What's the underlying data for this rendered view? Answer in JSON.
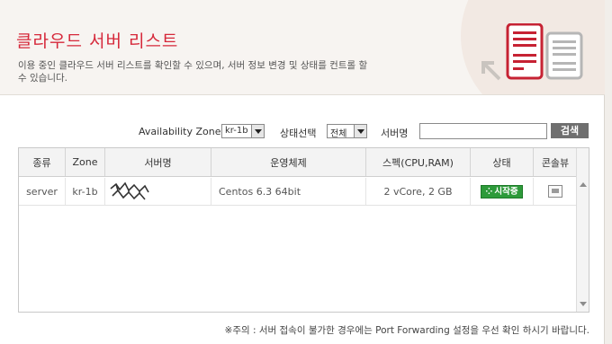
{
  "header": {
    "title": "클라우드 서버 리스트",
    "description": "이용 중인 클라우드 서버 리스트를 확인할 수 있으며, 서버 정보 변경 및 상태를 컨트롤 할 수 있습니다."
  },
  "filters": {
    "zone_label": "Availability Zone",
    "zone_value": "kr-1b",
    "status_label": "상태선택",
    "status_value": "전체",
    "name_label": "서버명",
    "name_value": "",
    "search_button": "검색"
  },
  "table": {
    "columns": [
      "종류",
      "Zone",
      "서버명",
      "운영체제",
      "스펙(CPU,RAM)",
      "상태",
      "콘솔뷰"
    ],
    "rows": [
      {
        "type": "server",
        "zone": "kr-1b",
        "os": "Centos 6.3 64bit",
        "spec": "2 vCore, 2 GB",
        "status": "시작중"
      }
    ]
  },
  "note": "※주의 : 서버 접속이 불가한 경우에는 Port Forwarding 설정을 우선 확인 하시기 바랍니다.",
  "colors": {
    "title": "#d6283a",
    "status_running": "#2d9a3a",
    "search_button": "#6f6f6f"
  },
  "icons": [
    "server-list-icon",
    "server-icon",
    "arrow-icon",
    "console-icon"
  ]
}
